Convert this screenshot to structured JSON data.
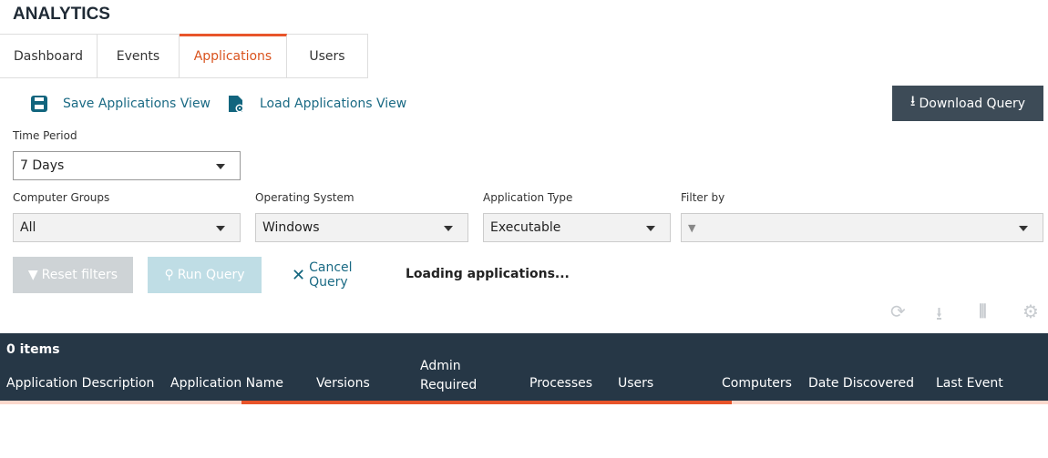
{
  "title": "ANALYTICS",
  "tabs": [
    {
      "label": "Dashboard"
    },
    {
      "label": "Events"
    },
    {
      "label": "Applications"
    },
    {
      "label": "Users"
    }
  ],
  "actions": {
    "save": "Save Applications View",
    "load": "Load Applications View",
    "download": "Download Query"
  },
  "filters": {
    "time_period": {
      "label": "Time Period",
      "value": "7 Days"
    },
    "computer_groups": {
      "label": "Computer Groups",
      "value": "All"
    },
    "os": {
      "label": "Operating System",
      "value": "Windows"
    },
    "app_type": {
      "label": "Application Type",
      "value": "Executable"
    },
    "filter_by": {
      "label": "Filter by",
      "value": ""
    }
  },
  "buttons": {
    "reset": "Reset filters",
    "run": "Run Query",
    "cancel": "Cancel Query"
  },
  "status": "Loading applications...",
  "table": {
    "count": "0 items",
    "columns": [
      "Application Description",
      "Application Name",
      "Versions",
      "Admin Required",
      "Processes",
      "Users",
      "Computers",
      "Date Discovered",
      "Last Event"
    ]
  }
}
